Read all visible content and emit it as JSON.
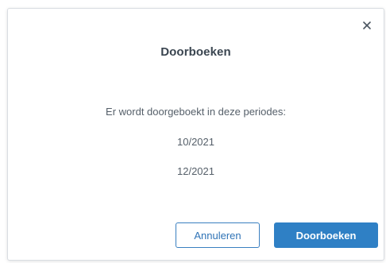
{
  "dialog": {
    "title": "Doorboeken",
    "message": "Er wordt doorgeboekt in deze periodes:",
    "periods": [
      "10/2021",
      "12/2021"
    ],
    "close_icon": "close-icon",
    "buttons": {
      "cancel_label": "Annuleren",
      "confirm_label": "Doorboeken"
    }
  },
  "colors": {
    "primary": "#2f80c5",
    "text": "#555f69",
    "title": "#3a4550"
  }
}
